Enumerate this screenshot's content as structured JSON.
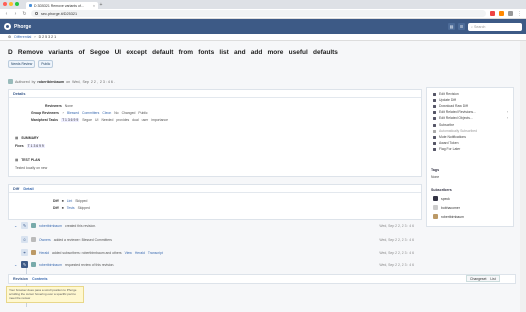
{
  "browser": {
    "tab_title": "D 3D5321 Remove variants of...",
    "url": "sec.phorge.it/D25321",
    "search_placeholder": "Search"
  },
  "app": {
    "brand": "Phorge",
    "crumb_app": "Differential",
    "crumb_item": "D 2 5 3 2 1"
  },
  "revision": {
    "title_words": [
      "D",
      "Remove",
      "variants",
      "of",
      "Segoe",
      "UI",
      "except",
      "default",
      "from",
      "fonts",
      "list",
      "and",
      "add",
      "more",
      "useful",
      "defaults"
    ],
    "tags": [
      "Needs Review",
      "Public"
    ],
    "author_line": [
      "Authored",
      "by",
      "robertbirnbaum",
      "on",
      "Wed,",
      "Sep",
      "2 2 ,",
      "2 3 : 4 6 ."
    ]
  },
  "details": {
    "header": "Details",
    "reviewers_label": "Reviewers",
    "reviewers_value": "None",
    "group_reviewers_label": "Group Reviewers",
    "group_reviewers": [
      "Blessed",
      "Committers",
      "Cleon",
      "No",
      "Changed",
      "Public"
    ],
    "maniphest_label": "Maniphest Tasks",
    "maniphest": [
      "T 1 3 6 9 9",
      "Segoe",
      "UI",
      "Needed",
      "provides",
      "dual",
      "user",
      "importance"
    ],
    "summary_header": "SUMMARY",
    "fixes_label": "Fixes",
    "fixes_value": "T 1 3 6 9 9",
    "test_plan_header": "TEST PLAN",
    "test_plan": "Tested locally on new"
  },
  "diff": {
    "header": "Diff",
    "detail_link": "Detail",
    "rows": [
      {
        "label": "Diff",
        "link": "Lint",
        "status": "Skipped"
      },
      {
        "label": "Diff",
        "link": "Tests",
        "status": "Skipped"
      }
    ]
  },
  "timeline": [
    {
      "actor": "robertbirnbaum",
      "action": "created this revision.",
      "date": "Wed, Sep 2 2, 2 3 : 4 6"
    },
    {
      "actor": "Owners",
      "action": "added a reviewer: Blessed Committers",
      "date": "Wed, Sep 2 2, 2 3 : 4 6"
    },
    {
      "actor": "Herald",
      "action": "added subscribers: robertbirnbaum and others",
      "date": "Wed, Sep 2 2, 2 3 : 4 6"
    },
    {
      "actor": "robertbirnbaum",
      "action": "requested review of this revision.",
      "date": "Wed, Sep 2 2, 2 3 : 4 6"
    }
  ],
  "herald_links": [
    "View",
    "Herald",
    "Transcript"
  ],
  "sidebar": {
    "actions": [
      {
        "label": "Edit Revision",
        "arrow": false
      },
      {
        "label": "Update Diff",
        "arrow": false
      },
      {
        "label": "Download Raw Diff",
        "arrow": false
      },
      {
        "label": "Edit Related Revisions...",
        "arrow": true
      },
      {
        "label": "Edit Related Objects...",
        "arrow": true
      },
      {
        "label": "Subscribe",
        "arrow": false
      },
      {
        "label": "Automatically Subscribed",
        "arrow": false
      },
      {
        "label": "Mute Notifications",
        "arrow": false
      },
      {
        "label": "Award Token",
        "arrow": false
      },
      {
        "label": "Flag For Later",
        "arrow": false
      }
    ],
    "tags_header": "Tags",
    "tags_value": "None",
    "subscribers_header": "Subscribers",
    "subscribers": [
      "speck",
      "bobhacomer",
      "robertbirnbaum"
    ]
  },
  "revision_contents": {
    "header": "Revision",
    "tab": "Contents",
    "changeset_button": "Changeset",
    "list_button": "List"
  },
  "tooltip": "Your browser does pass a scroll position to Phorge scrolling the cursor hovering over a specific part to meet the review"
}
